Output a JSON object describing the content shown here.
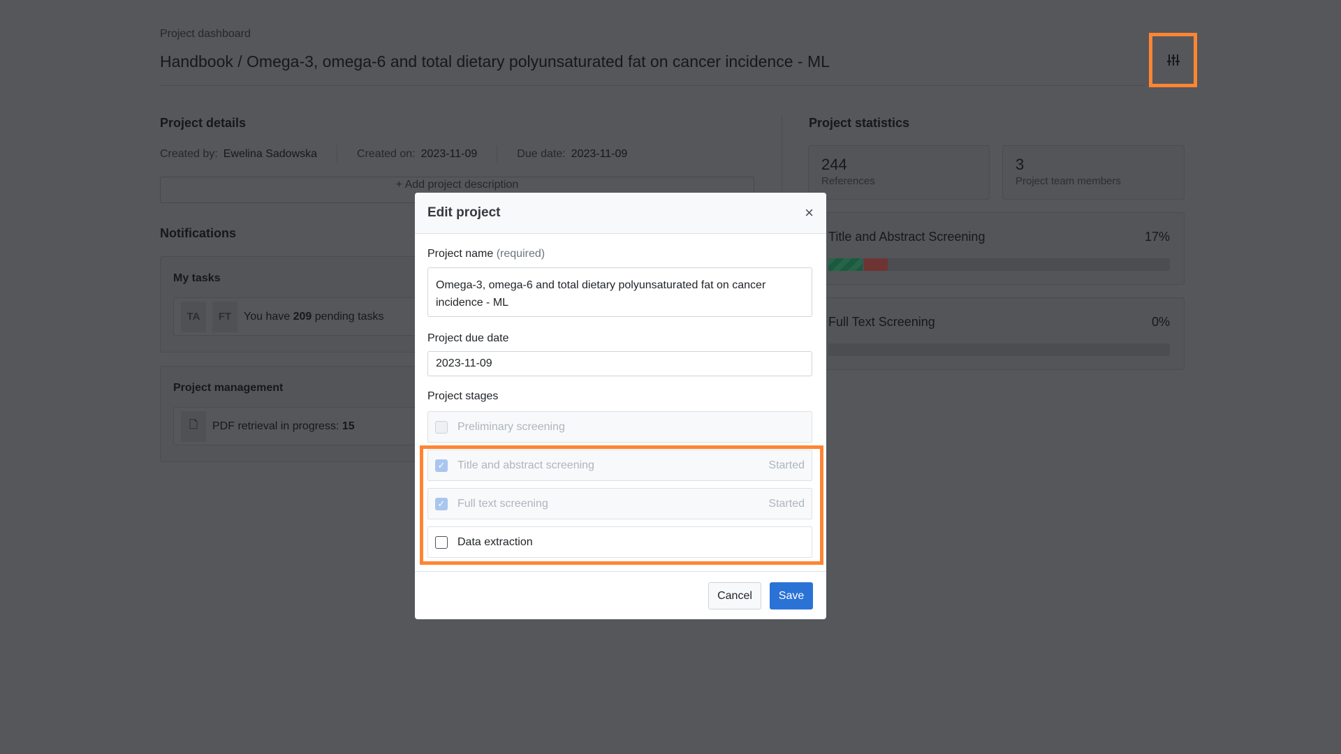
{
  "header": {
    "breadcrumb": "Project dashboard",
    "title": "Handbook / Omega-3, omega-6 and total dietary polyunsaturated fat on cancer incidence - ML",
    "settings_icon": "sliders-icon"
  },
  "details": {
    "heading": "Project details",
    "created_by_label": "Created by:",
    "created_by": "Ewelina Sadowska",
    "created_on_label": "Created on:",
    "created_on": "2023-11-09",
    "due_label": "Due date:",
    "due": "2023-11-09",
    "add_description": "+ Add project description"
  },
  "notifications": {
    "heading": "Notifications",
    "my_tasks": {
      "title": "My tasks",
      "tags": [
        "TA",
        "FT"
      ],
      "text_pre": "You have",
      "count": "209",
      "text_post": "pending tasks"
    },
    "management": {
      "title": "Project management",
      "text": "PDF retrieval in progress:",
      "count": "15"
    }
  },
  "statistics": {
    "heading": "Project statistics",
    "references": "244",
    "references_label": "References",
    "members": "3",
    "members_label": "Project team members",
    "stages": [
      {
        "name": "Title and Abstract Screening",
        "percent_label": "17%",
        "included_fraction": 0.1,
        "excluded_fraction": 0.07
      },
      {
        "name": "Full Text Screening",
        "percent_label": "0%"
      }
    ]
  },
  "modal": {
    "title": "Edit project",
    "close": "×",
    "name_label": "Project name",
    "name_required": "(required)",
    "name_value": "Omega-3, omega-6 and total dietary polyunsaturated fat on cancer incidence - ML",
    "due_label": "Project due date",
    "due_value": "2023-11-09",
    "stages_label": "Project stages",
    "stages": [
      {
        "name": "Preliminary screening",
        "status": "",
        "checked": false
      },
      {
        "name": "Title and abstract screening",
        "status": "Started",
        "checked": true
      },
      {
        "name": "Full text screening",
        "status": "Started",
        "checked": true
      },
      {
        "name": "Data extraction",
        "status": "",
        "checked": false
      }
    ],
    "cancel": "Cancel",
    "save": "Save"
  },
  "colors": {
    "highlight": "#ff8533",
    "primary": "#2b72d6",
    "included": "#1e8a5a",
    "excluded": "#c0392b"
  }
}
